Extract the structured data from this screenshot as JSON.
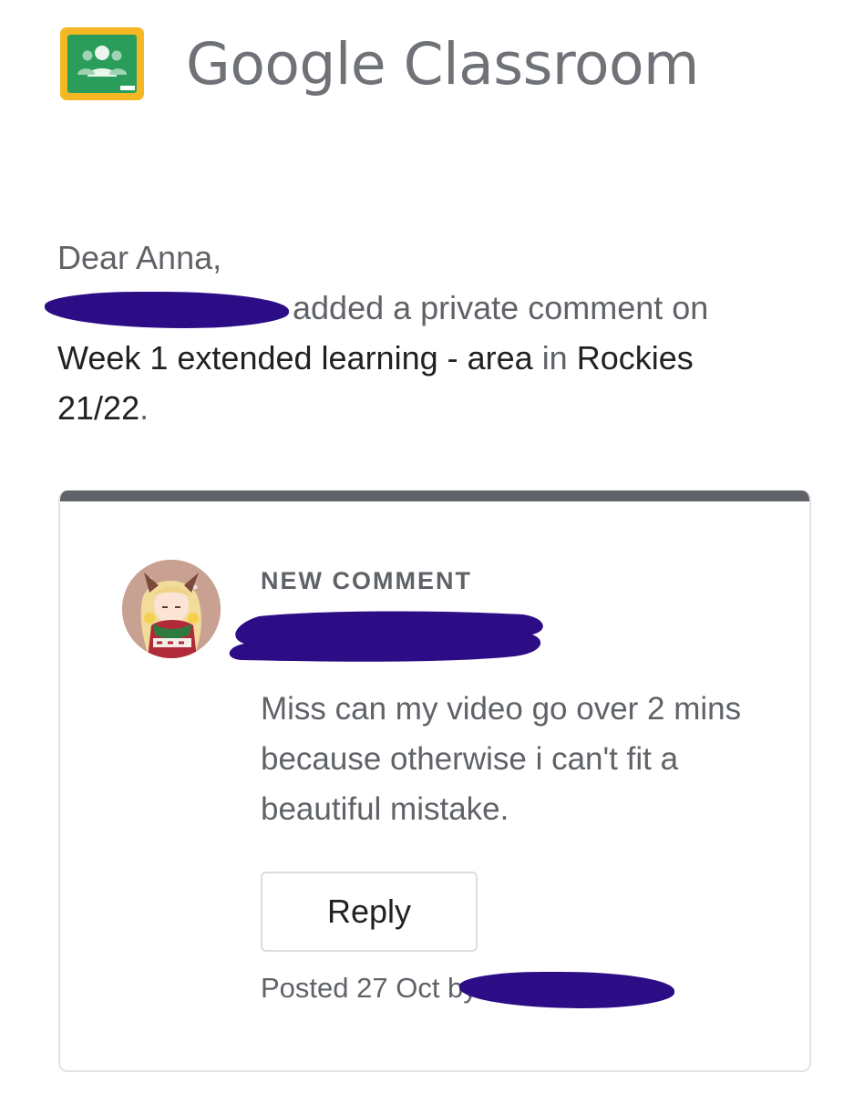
{
  "brand": {
    "name": "Google Classroom",
    "logo_icon": "classroom-logo-icon"
  },
  "email": {
    "greeting": "Dear Anna,",
    "action_text": "added a private comment on",
    "assignment": "Week 1 extended learning - area",
    "connector": "in",
    "class_name": "Rockies 21/22",
    "end_punct": "."
  },
  "comment": {
    "label": "NEW COMMENT",
    "message": "Miss can my video go over 2 mins because otherwise i can't fit a beautiful mistake.",
    "reply_label": "Reply",
    "posted_prefix": "Posted 27 Oct by"
  },
  "colors": {
    "redaction": "#2d0d86",
    "logo_board": "#2a9d5a",
    "logo_frame": "#f6b725",
    "card_bar": "#5f6368"
  }
}
